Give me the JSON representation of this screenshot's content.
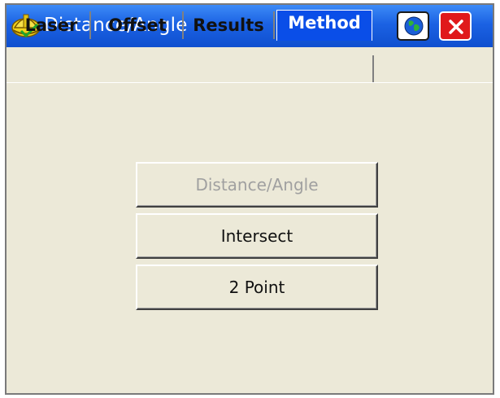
{
  "window": {
    "title": "Distance/Angle",
    "app_icon": "hardhat-icon",
    "globe_icon": "globe-icon",
    "close_icon": "close-icon"
  },
  "tabs": [
    {
      "label": "Laser",
      "active": false
    },
    {
      "label": "Offset",
      "active": false
    },
    {
      "label": "Results",
      "active": false
    },
    {
      "label": "Method",
      "active": true
    }
  ],
  "method_buttons": [
    {
      "label": "Distance/Angle",
      "enabled": false
    },
    {
      "label": "Intersect",
      "enabled": true
    },
    {
      "label": "2 Point",
      "enabled": true
    }
  ],
  "colors": {
    "titlebar": "#1b62e3",
    "active_tab": "#0a4ee8",
    "close_button": "#e0191b",
    "background": "#ece9d8"
  }
}
